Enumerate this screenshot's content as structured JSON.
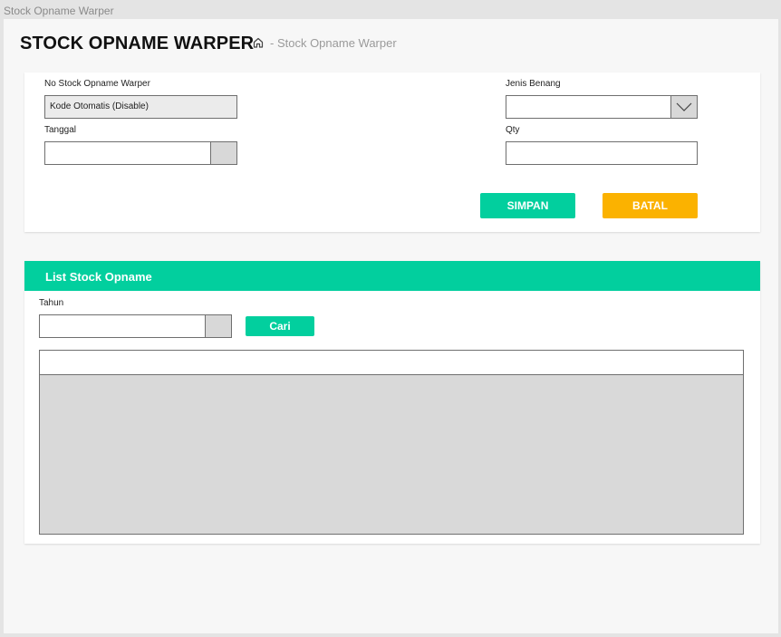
{
  "window": {
    "tab_title": "Stock Opname Warper"
  },
  "header": {
    "title": "STOCK OPNAME WARPER",
    "breadcrumb": "- Stock Opname Warper"
  },
  "form": {
    "no_label": "No Stock Opname Warper",
    "no_value": "Kode Otomatis (Disable)",
    "tanggal_label": "Tanggal",
    "tanggal_value": "",
    "jenis_label": "Jenis Benang",
    "jenis_value": "",
    "qty_label": "Qty",
    "qty_value": "",
    "save_label": "SIMPAN",
    "cancel_label": "BATAL"
  },
  "list": {
    "title": "List Stock Opname",
    "tahun_label": "Tahun",
    "tahun_value": "",
    "search_label": "Cari"
  },
  "colors": {
    "primary": "#02cf9e",
    "warning": "#fbb200",
    "disabled_bg": "#ebebeb",
    "table_body": "#d9d9d9"
  },
  "icons": {
    "breadcrumb_home": "home-icon",
    "select_toggle": "chevron-down-icon"
  }
}
